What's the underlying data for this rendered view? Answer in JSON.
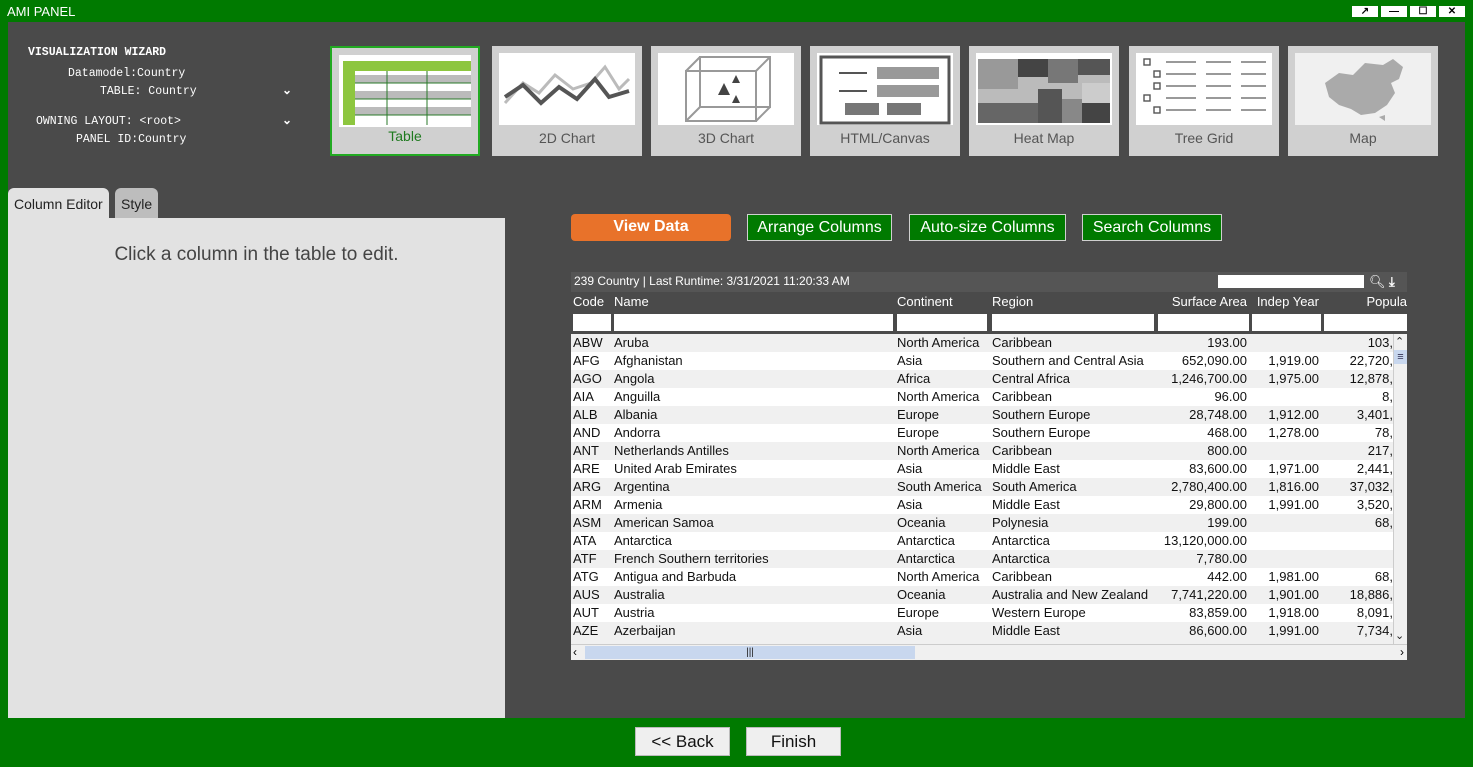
{
  "window": {
    "title": "AMI PANEL",
    "controls": [
      "↗",
      "—",
      "☐",
      "✕"
    ]
  },
  "wizard": {
    "heading": "VISUALIZATION WIZARD",
    "datamodel": "Datamodel:Country",
    "table": "TABLE: Country",
    "owning_layout": "OWNING LAYOUT: <root>",
    "panel_id": "PANEL ID:Country"
  },
  "visualizations": [
    {
      "label": "Table",
      "icon": "table-icon",
      "selected": true
    },
    {
      "label": "2D Chart",
      "icon": "line-chart-icon"
    },
    {
      "label": "3D Chart",
      "icon": "cube-icon"
    },
    {
      "label": "HTML/Canvas",
      "icon": "form-icon"
    },
    {
      "label": "Heat Map",
      "icon": "heatmap-icon"
    },
    {
      "label": "Tree Grid",
      "icon": "tree-grid-icon"
    },
    {
      "label": "Map",
      "icon": "map-icon"
    }
  ],
  "tabs": {
    "column_editor": "Column Editor",
    "style": "Style"
  },
  "column_editor": {
    "message": "Click a column in the table to edit."
  },
  "actions": {
    "view_data": "View Data",
    "arrange_columns": "Arrange Columns",
    "auto_size_columns": "Auto-size Columns",
    "search_columns": "Search Columns"
  },
  "grid": {
    "header": "239 Country | Last Runtime: 3/31/2021 11:20:33 AM",
    "columns": [
      "Code",
      "Name",
      "Continent",
      "Region",
      "Surface Area",
      "Indep Year",
      "Popula"
    ],
    "rows": [
      [
        "ABW",
        "Aruba",
        "North America",
        "Caribbean",
        "193.00",
        "",
        "103,"
      ],
      [
        "AFG",
        "Afghanistan",
        "Asia",
        "Southern and Central Asia",
        "652,090.00",
        "1,919.00",
        "22,720,"
      ],
      [
        "AGO",
        "Angola",
        "Africa",
        "Central Africa",
        "1,246,700.00",
        "1,975.00",
        "12,878,"
      ],
      [
        "AIA",
        "Anguilla",
        "North America",
        "Caribbean",
        "96.00",
        "",
        "8,"
      ],
      [
        "ALB",
        "Albania",
        "Europe",
        "Southern Europe",
        "28,748.00",
        "1,912.00",
        "3,401,"
      ],
      [
        "AND",
        "Andorra",
        "Europe",
        "Southern Europe",
        "468.00",
        "1,278.00",
        "78,"
      ],
      [
        "ANT",
        "Netherlands Antilles",
        "North America",
        "Caribbean",
        "800.00",
        "",
        "217,"
      ],
      [
        "ARE",
        "United Arab Emirates",
        "Asia",
        "Middle East",
        "83,600.00",
        "1,971.00",
        "2,441,"
      ],
      [
        "ARG",
        "Argentina",
        "South America",
        "South America",
        "2,780,400.00",
        "1,816.00",
        "37,032,"
      ],
      [
        "ARM",
        "Armenia",
        "Asia",
        "Middle East",
        "29,800.00",
        "1,991.00",
        "3,520,"
      ],
      [
        "ASM",
        "American Samoa",
        "Oceania",
        "Polynesia",
        "199.00",
        "",
        "68,"
      ],
      [
        "ATA",
        "Antarctica",
        "Antarctica",
        "Antarctica",
        "13,120,000.00",
        "",
        ""
      ],
      [
        "ATF",
        "French Southern territories",
        "Antarctica",
        "Antarctica",
        "7,780.00",
        "",
        ""
      ],
      [
        "ATG",
        "Antigua and Barbuda",
        "North America",
        "Caribbean",
        "442.00",
        "1,981.00",
        "68,"
      ],
      [
        "AUS",
        "Australia",
        "Oceania",
        "Australia and New Zealand",
        "7,741,220.00",
        "1,901.00",
        "18,886,"
      ],
      [
        "AUT",
        "Austria",
        "Europe",
        "Western Europe",
        "83,859.00",
        "1,918.00",
        "8,091,"
      ],
      [
        "AZE",
        "Azerbaijan",
        "Asia",
        "Middle East",
        "86,600.00",
        "1,991.00",
        "7,734,"
      ]
    ]
  },
  "nav": {
    "back": "<< Back",
    "finish": "Finish"
  },
  "colors": {
    "frame_green": "#007a00",
    "panel_bg": "#4a4a4a",
    "accent_orange": "#e8722a"
  }
}
